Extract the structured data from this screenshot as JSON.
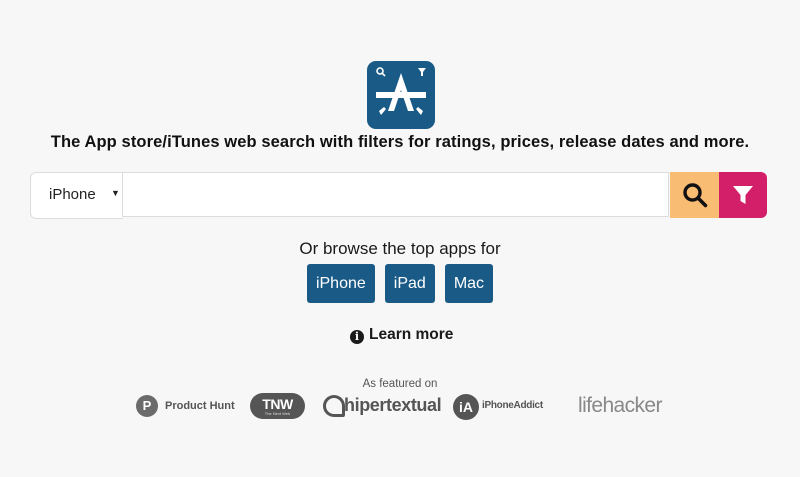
{
  "brand": {
    "logo_icon": "app-store-search-filter-icon",
    "logo_color": "#1a5a86"
  },
  "tagline": "The App store/iTunes web search with filters for ratings, prices, release dates and more.",
  "search": {
    "device_selected": "iPhone",
    "query_value": "",
    "search_button_icon": "search-icon",
    "filter_button_icon": "filter-icon",
    "search_button_color": "#f9bc73",
    "filter_button_color": "#d31f6a"
  },
  "browse": {
    "prompt": "Or browse the top apps for",
    "buttons": [
      "iPhone",
      "iPad",
      "Mac"
    ],
    "button_color": "#1a5a86"
  },
  "learn_more": {
    "icon": "info-icon",
    "label": "Learn more"
  },
  "featured": {
    "title": "As featured on",
    "logos": [
      {
        "name": "Product Hunt",
        "mark": "P"
      },
      {
        "name": "TNW",
        "sub": "The Next Web"
      },
      {
        "name": "hipertextual"
      },
      {
        "name": "iPhoneAddict",
        "mark": "iA"
      },
      {
        "name": "lifehacker"
      }
    ]
  }
}
